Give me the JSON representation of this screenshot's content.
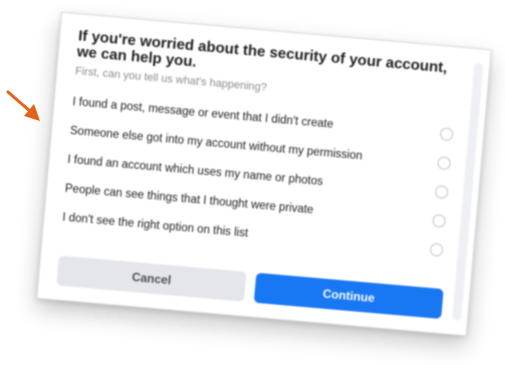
{
  "dialog": {
    "title": "If you're worried about the security of your account, we can help you.",
    "subtitle": "First, can you tell us what's happening?",
    "options": [
      {
        "label": "I found a post, message or event that I didn't create",
        "selected": false
      },
      {
        "label": "Someone else got into my account without my permission",
        "selected": false
      },
      {
        "label": "I found an account which uses my name or photos",
        "selected": false
      },
      {
        "label": "People can see things that I thought were private",
        "selected": false
      },
      {
        "label": "I don't see the right option on this list",
        "selected": false
      }
    ],
    "cancel_label": "Cancel",
    "continue_label": "Continue"
  },
  "colors": {
    "arrow": "#e8611a",
    "primary_button": "#1877f2",
    "secondary_button": "#e4e6eb"
  }
}
